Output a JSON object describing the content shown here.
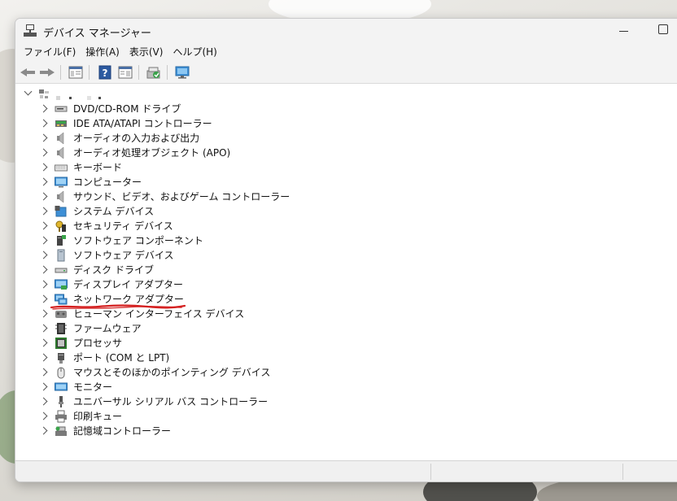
{
  "window": {
    "title": "デバイス マネージャー"
  },
  "menu": [
    {
      "label": "ファイル(F)"
    },
    {
      "label": "操作(A)"
    },
    {
      "label": "表示(V)"
    },
    {
      "label": "ヘルプ(H)"
    }
  ],
  "toolbar": {
    "buttons": [
      "back-icon",
      "forward-icon",
      "properties-pane-icon",
      "help-icon",
      "show-hide-pane-icon",
      "update-driver-icon",
      "scan-hardware-icon"
    ]
  },
  "tree": {
    "root_label": "",
    "categories": [
      {
        "label": "DVD/CD-ROM ドライブ",
        "icon": "dvd-drive-icon"
      },
      {
        "label": "IDE ATA/ATAPI コントローラー",
        "icon": "ide-controller-icon"
      },
      {
        "label": "オーディオの入力および出力",
        "icon": "speaker-icon"
      },
      {
        "label": "オーディオ処理オブジェクト (APO)",
        "icon": "speaker-icon"
      },
      {
        "label": "キーボード",
        "icon": "keyboard-icon"
      },
      {
        "label": "コンピューター",
        "icon": "computer-icon"
      },
      {
        "label": "サウンド、ビデオ、およびゲーム コントローラー",
        "icon": "speaker-icon"
      },
      {
        "label": "システム デバイス",
        "icon": "system-device-icon"
      },
      {
        "label": "セキュリティ デバイス",
        "icon": "security-device-icon"
      },
      {
        "label": "ソフトウェア コンポーネント",
        "icon": "software-component-icon"
      },
      {
        "label": "ソフトウェア デバイス",
        "icon": "software-device-icon"
      },
      {
        "label": "ディスク ドライブ",
        "icon": "disk-drive-icon"
      },
      {
        "label": "ディスプレイ アダプター",
        "icon": "display-adapter-icon"
      },
      {
        "label": "ネットワーク アダプター",
        "icon": "network-adapter-icon"
      },
      {
        "label": "ヒューマン インターフェイス デバイス",
        "icon": "hid-icon"
      },
      {
        "label": "ファームウェア",
        "icon": "firmware-icon"
      },
      {
        "label": "プロセッサ",
        "icon": "processor-icon"
      },
      {
        "label": "ポート (COM と LPT)",
        "icon": "port-icon"
      },
      {
        "label": "マウスとそのほかのポインティング デバイス",
        "icon": "mouse-icon"
      },
      {
        "label": "モニター",
        "icon": "monitor-icon"
      },
      {
        "label": "ユニバーサル シリアル バス コントローラー",
        "icon": "usb-icon"
      },
      {
        "label": "印刷キュー",
        "icon": "printer-icon"
      },
      {
        "label": "記憶域コントローラー",
        "icon": "storage-controller-icon"
      }
    ]
  },
  "annotation": {
    "color": "#d42020"
  }
}
